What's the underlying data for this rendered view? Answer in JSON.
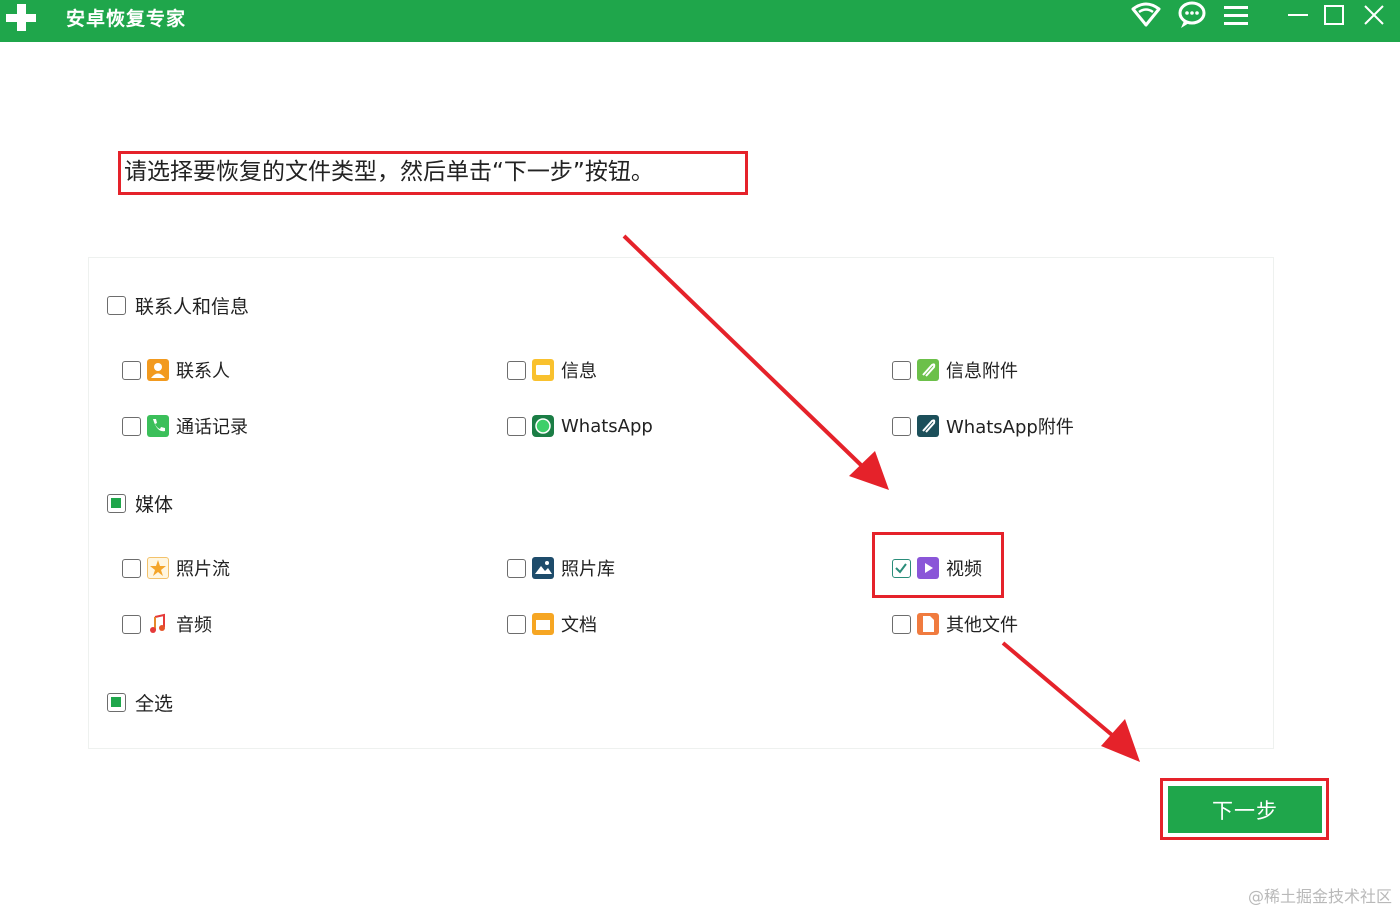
{
  "window": {
    "title": "安卓恢复专家",
    "brand_color": "#1fa64b",
    "icons": [
      "plus-logo-icon",
      "wifi-icon",
      "chat-icon",
      "menu-icon",
      "minimize-icon",
      "maximize-icon",
      "close-icon"
    ]
  },
  "instruction": "请选择要恢复的文件类型，然后单击“下一步”按钮。",
  "groups": {
    "contacts": {
      "label": "联系人和信息",
      "state": "unchecked"
    },
    "media": {
      "label": "媒体",
      "state": "partial"
    },
    "select_all": {
      "label": "全选",
      "state": "partial"
    }
  },
  "items": {
    "contacts": {
      "label": "联系人",
      "checked": false,
      "icon": "contact-icon"
    },
    "messages": {
      "label": "信息",
      "checked": false,
      "icon": "message-icon"
    },
    "message_attachments": {
      "label": "信息附件",
      "checked": false,
      "icon": "attachment-icon"
    },
    "call_log": {
      "label": "通话记录",
      "checked": false,
      "icon": "phone-icon"
    },
    "whatsapp": {
      "label": "WhatsApp",
      "checked": false,
      "icon": "whatsapp-icon"
    },
    "whatsapp_attachments": {
      "label": "WhatsApp附件",
      "checked": false,
      "icon": "whatsapp-attachment-icon"
    },
    "photo_stream": {
      "label": "照片流",
      "checked": false,
      "icon": "photo-stream-icon"
    },
    "photo_library": {
      "label": "照片库",
      "checked": false,
      "icon": "photo-library-icon"
    },
    "video": {
      "label": "视频",
      "checked": true,
      "icon": "video-icon"
    },
    "audio": {
      "label": "音频",
      "checked": false,
      "icon": "audio-icon"
    },
    "documents": {
      "label": "文档",
      "checked": false,
      "icon": "folder-icon"
    },
    "other_files": {
      "label": "其他文件",
      "checked": false,
      "icon": "file-icon"
    }
  },
  "next_button": "下一步",
  "watermark": "@稀土掘金技术社区",
  "colors": {
    "highlight": "#e5222a",
    "check": "#2a8d7a"
  }
}
